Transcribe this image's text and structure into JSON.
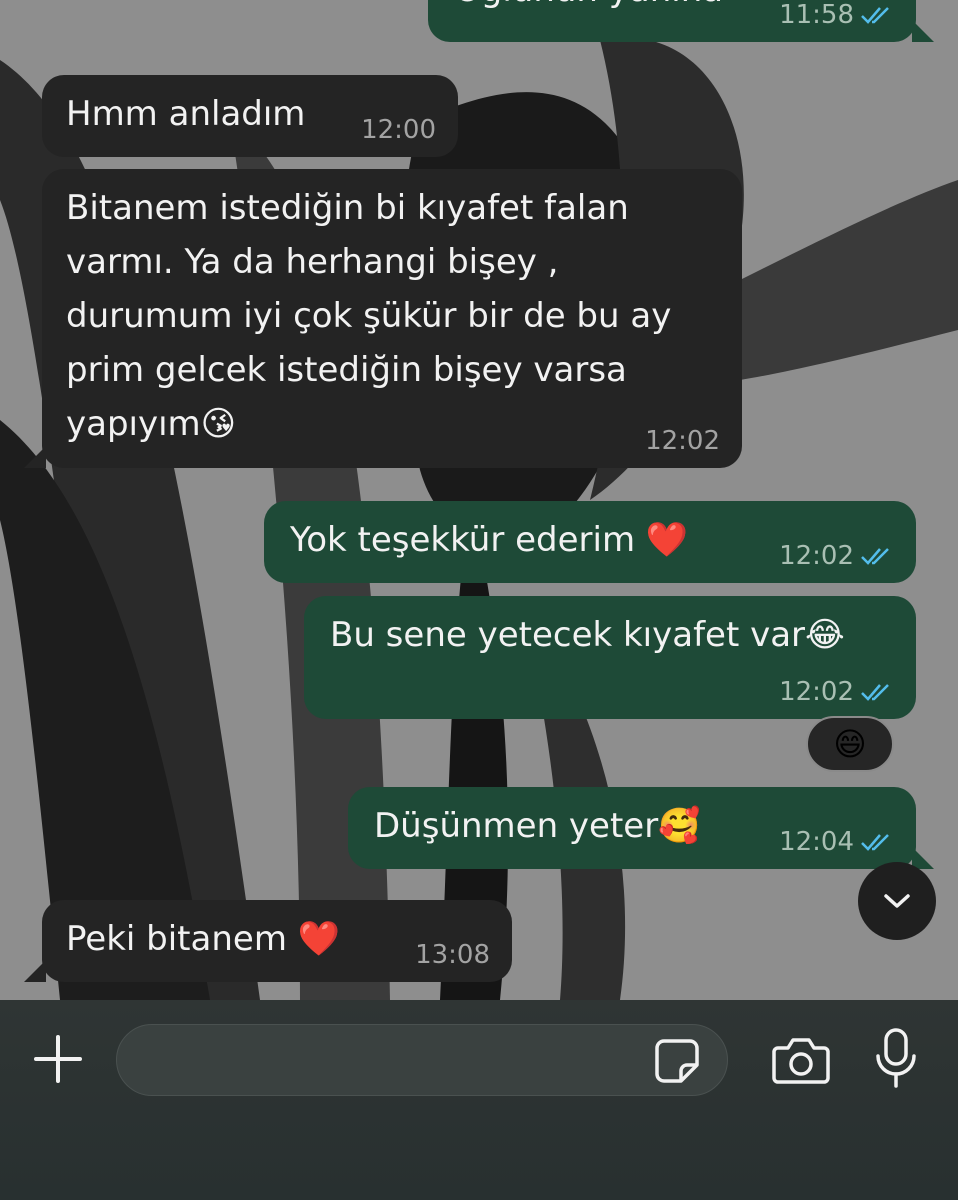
{
  "messages": [
    {
      "id": "m0",
      "direction": "out",
      "text": "Oğlunun yanına",
      "time": "11:58",
      "read": true
    },
    {
      "id": "m1",
      "direction": "in",
      "text": "Hmm anladım",
      "time": "12:00"
    },
    {
      "id": "m2",
      "direction": "in",
      "lines": [
        "Bitanem istediğin bi kıyafet falan",
        "varmı. Ya da herhangi bişey ,",
        "durumum iyi çok şükür bir de bu ay",
        "prim gelcek istediğin bişey varsa",
        "yapıyım😘"
      ],
      "time": "12:02"
    },
    {
      "id": "m3",
      "direction": "out",
      "text": "Yok teşekkür ederim ❤️",
      "time": "12:02",
      "read": true
    },
    {
      "id": "m4",
      "direction": "out",
      "text": "Bu sene yetecek kıyafet var😂",
      "time": "12:02",
      "read": true,
      "reaction": "😄"
    },
    {
      "id": "m5",
      "direction": "out",
      "text": "Düşünmen yeter🥰",
      "time": "12:04",
      "read": true
    },
    {
      "id": "m6",
      "direction": "in",
      "text": "Peki bitanem ❤️",
      "time": "13:08"
    }
  ],
  "composer": {
    "placeholder": "",
    "value": ""
  },
  "colors": {
    "incoming_bubble": "#242424",
    "outgoing_bubble": "#1e4a37",
    "read_ticks": "#53bdeb"
  },
  "icons": {
    "attach": "plus-icon",
    "sticker": "sticker-icon",
    "camera": "camera-icon",
    "voice": "microphone-icon",
    "scroll": "chevron-down-icon"
  }
}
